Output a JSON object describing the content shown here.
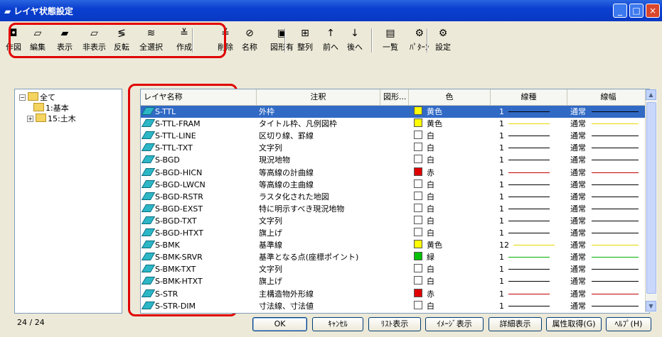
{
  "window": {
    "title": "レイヤ状態設定",
    "min": "_",
    "max": "□",
    "close": "×"
  },
  "toolbar": {
    "tools": [
      {
        "name": "tool-create-figure",
        "glyph": "◘",
        "label": "作図"
      },
      {
        "name": "tool-edit",
        "glyph": "▱",
        "label": "編集"
      },
      {
        "name": "tool-show",
        "glyph": "▰",
        "label": "表示"
      },
      {
        "name": "tool-hide",
        "glyph": "▱",
        "label": "非表示"
      },
      {
        "name": "tool-invert",
        "glyph": "≶",
        "label": "反転"
      },
      {
        "name": "tool-select-all",
        "glyph": "≋",
        "label": "全選択"
      },
      {
        "name": "tool-create",
        "glyph": "≚",
        "label": "作成"
      },
      {
        "name": "tool-delete",
        "glyph": "≚",
        "label": "削除"
      },
      {
        "name": "tool-name",
        "glyph": "⊘",
        "label": "名称"
      },
      {
        "name": "tool-figure-exists",
        "glyph": "▣",
        "label": "図形有"
      },
      {
        "name": "tool-sort",
        "glyph": "⊞",
        "label": "整列"
      },
      {
        "name": "tool-forward",
        "glyph": "↑",
        "label": "前へ"
      },
      {
        "name": "tool-back",
        "glyph": "↓",
        "label": "後へ"
      },
      {
        "name": "tool-list",
        "glyph": "▤",
        "label": "一覧"
      },
      {
        "name": "tool-pattern",
        "glyph": "⚙",
        "label": "ﾊﾟﾀｰﾝ"
      },
      {
        "name": "tool-settings",
        "glyph": "⚙",
        "label": "設定"
      }
    ]
  },
  "tree": {
    "root": "全て",
    "children": [
      "1:基本",
      "15:土木"
    ],
    "root_toggle": "−",
    "child_toggle": "+"
  },
  "grid": {
    "columns": [
      "レイヤ名称",
      "注釈",
      "図形...",
      "色",
      "線種",
      "線幅"
    ],
    "rows": [
      {
        "name": "S-TTL",
        "note": "外枠",
        "color_hex": "#ffff00",
        "color": "黄色",
        "lt_num": "1",
        "lt_hex": "#000000",
        "width": "通常",
        "lw_hex": "#000000"
      },
      {
        "name": "S-TTL-FRAM",
        "note": "タイトル枠、凡例図枠",
        "color_hex": "#ffff00",
        "color": "黄色",
        "lt_num": "1",
        "lt_hex": "#e6d800",
        "width": "通常",
        "lw_hex": "#e6d800"
      },
      {
        "name": "S-TTL-LINE",
        "note": "区切り線、罫線",
        "color_hex": "#ffffff",
        "color": "白",
        "lt_num": "1",
        "lt_hex": "#000000",
        "width": "通常",
        "lw_hex": "#000000"
      },
      {
        "name": "S-TTL-TXT",
        "note": "文字列",
        "color_hex": "#ffffff",
        "color": "白",
        "lt_num": "1",
        "lt_hex": "#000000",
        "width": "通常",
        "lw_hex": "#000000"
      },
      {
        "name": "S-BGD",
        "note": "現況地物",
        "color_hex": "#ffffff",
        "color": "白",
        "lt_num": "1",
        "lt_hex": "#000000",
        "width": "通常",
        "lw_hex": "#000000"
      },
      {
        "name": "S-BGD-HICN",
        "note": "等高線の計曲線",
        "color_hex": "#e00000",
        "color": "赤",
        "lt_num": "1",
        "lt_hex": "#c00000",
        "width": "通常",
        "lw_hex": "#c00000"
      },
      {
        "name": "S-BGD-LWCN",
        "note": "等高線の主曲線",
        "color_hex": "#ffffff",
        "color": "白",
        "lt_num": "1",
        "lt_hex": "#000000",
        "width": "通常",
        "lw_hex": "#000000"
      },
      {
        "name": "S-BGD-RSTR",
        "note": "ラスタ化された地図",
        "color_hex": "#ffffff",
        "color": "白",
        "lt_num": "1",
        "lt_hex": "#000000",
        "width": "通常",
        "lw_hex": "#000000"
      },
      {
        "name": "S-BGD-EXST",
        "note": "特に明示すべき現況地物",
        "color_hex": "#ffffff",
        "color": "白",
        "lt_num": "1",
        "lt_hex": "#000000",
        "width": "通常",
        "lw_hex": "#000000"
      },
      {
        "name": "S-BGD-TXT",
        "note": "文字列",
        "color_hex": "#ffffff",
        "color": "白",
        "lt_num": "1",
        "lt_hex": "#000000",
        "width": "通常",
        "lw_hex": "#000000"
      },
      {
        "name": "S-BGD-HTXT",
        "note": "旗上げ",
        "color_hex": "#ffffff",
        "color": "白",
        "lt_num": "1",
        "lt_hex": "#000000",
        "width": "通常",
        "lw_hex": "#000000"
      },
      {
        "name": "S-BMK",
        "note": "基準線",
        "color_hex": "#ffff00",
        "color": "黄色",
        "lt_num": "12",
        "lt_hex": "#e6d800",
        "width": "通常",
        "lw_hex": "#e6d800"
      },
      {
        "name": "S-BMK-SRVR",
        "note": "基準となる点(座標ポイント)",
        "color_hex": "#00c000",
        "color": "緑",
        "lt_num": "1",
        "lt_hex": "#00b000",
        "width": "通常",
        "lw_hex": "#00b000"
      },
      {
        "name": "S-BMK-TXT",
        "note": "文字列",
        "color_hex": "#ffffff",
        "color": "白",
        "lt_num": "1",
        "lt_hex": "#000000",
        "width": "通常",
        "lw_hex": "#000000"
      },
      {
        "name": "S-BMK-HTXT",
        "note": "旗上げ",
        "color_hex": "#ffffff",
        "color": "白",
        "lt_num": "1",
        "lt_hex": "#000000",
        "width": "通常",
        "lw_hex": "#000000"
      },
      {
        "name": "S-STR",
        "note": "主構造物外形線",
        "color_hex": "#e00000",
        "color": "赤",
        "lt_num": "1",
        "lt_hex": "#c00000",
        "width": "通常",
        "lw_hex": "#c00000"
      },
      {
        "name": "S-STR-DIM",
        "note": "寸法線、寸法値",
        "color_hex": "#ffffff",
        "color": "白",
        "lt_num": "1",
        "lt_hex": "#000000",
        "width": "通常",
        "lw_hex": "#000000"
      }
    ],
    "scroll_up": "▲",
    "scroll_down": "▼"
  },
  "footer": {
    "count": "24 / 24",
    "buttons": [
      {
        "name": "ok-button",
        "label": "OK"
      },
      {
        "name": "cancel-button",
        "label": "ｷｬﾝｾﾙ"
      },
      {
        "name": "list-view-button",
        "label": "ﾘｽﾄ表示"
      },
      {
        "name": "image-view-button",
        "label": "ｲﾒｰｼﾞ表示"
      },
      {
        "name": "detail-view-button",
        "label": "詳細表示"
      },
      {
        "name": "get-attributes-button",
        "label": "属性取得(G)"
      },
      {
        "name": "help-button",
        "label": "ﾍﾙﾌﾟ(H)"
      }
    ]
  }
}
